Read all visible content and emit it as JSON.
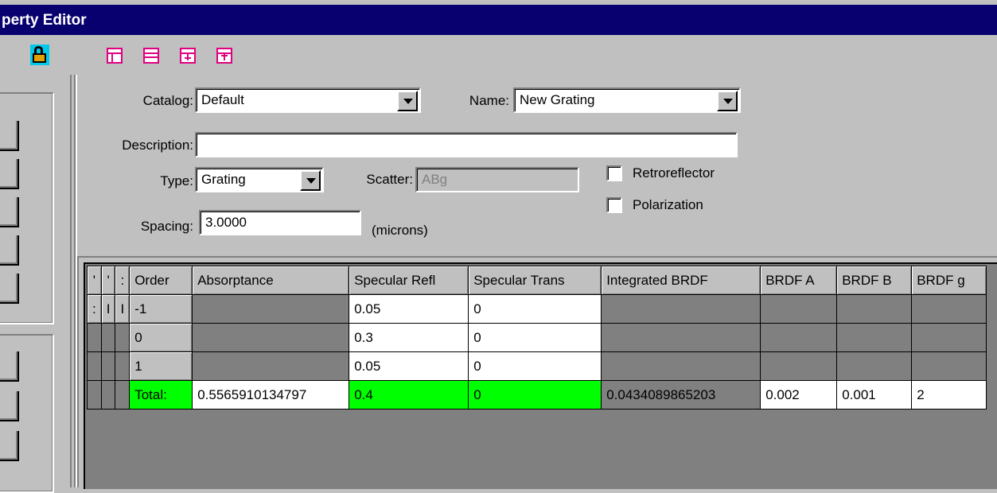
{
  "window": {
    "title": "perty Editor"
  },
  "toolbar": {
    "icons": [
      "lock-icon",
      "layout-table-icon",
      "layout-rows-icon",
      "insert-row-below-icon",
      "insert-row-above-icon"
    ]
  },
  "left_panel": {
    "buttons": [
      "",
      "",
      "",
      "",
      "",
      "",
      "",
      ""
    ]
  },
  "form": {
    "catalog_label": "Catalog:",
    "catalog_value": "Default",
    "name_label": "Name:",
    "name_value": "New Grating",
    "description_label": "Description:",
    "description_value": "",
    "type_label": "Type:",
    "type_value": "Grating",
    "scatter_label": "Scatter:",
    "scatter_value": "ABg",
    "retroreflector_label": "Retroreflector",
    "retroreflector_checked": false,
    "polarization_label": "Polarization",
    "polarization_checked": false,
    "spacing_label": "Spacing:",
    "spacing_value": "3.0000",
    "spacing_unit": "(microns)"
  },
  "grid": {
    "headers": {
      "c1": "'",
      "c2": "'",
      "c3": ":",
      "order": "Order",
      "absorptance": "Absorptance",
      "spec_refl": "Specular Refl",
      "spec_trans": "Specular Trans",
      "int_brdf": "Integrated BRDF",
      "brdf_a": "BRDF A",
      "brdf_b": "BRDF B",
      "brdf_g": "BRDF g"
    },
    "rows": [
      {
        "m1": ":",
        "m2": "I",
        "m3": "I",
        "order": "-1",
        "absorptance": "",
        "spec_refl": "0.05",
        "spec_trans": "0",
        "int_brdf": "",
        "brdf_a": "",
        "brdf_b": "",
        "brdf_g": ""
      },
      {
        "m1": "",
        "m2": "",
        "m3": "",
        "order": "0",
        "absorptance": "",
        "spec_refl": "0.3",
        "spec_trans": "0",
        "int_brdf": "",
        "brdf_a": "",
        "brdf_b": "",
        "brdf_g": ""
      },
      {
        "m1": "",
        "m2": "",
        "m3": "",
        "order": "1",
        "absorptance": "",
        "spec_refl": "0.05",
        "spec_trans": "0",
        "int_brdf": "",
        "brdf_a": "",
        "brdf_b": "",
        "brdf_g": ""
      }
    ],
    "total": {
      "order": "Total:",
      "absorptance": "0.5565910134797",
      "spec_refl": "0.4",
      "spec_trans": "0",
      "int_brdf": "0.0434089865203",
      "brdf_a": "0.002",
      "brdf_b": "0.001",
      "brdf_g": "2"
    }
  },
  "colors": {
    "title_bar": "#08006e",
    "highlight": "#00ff00",
    "face": "#c0c0c0"
  }
}
